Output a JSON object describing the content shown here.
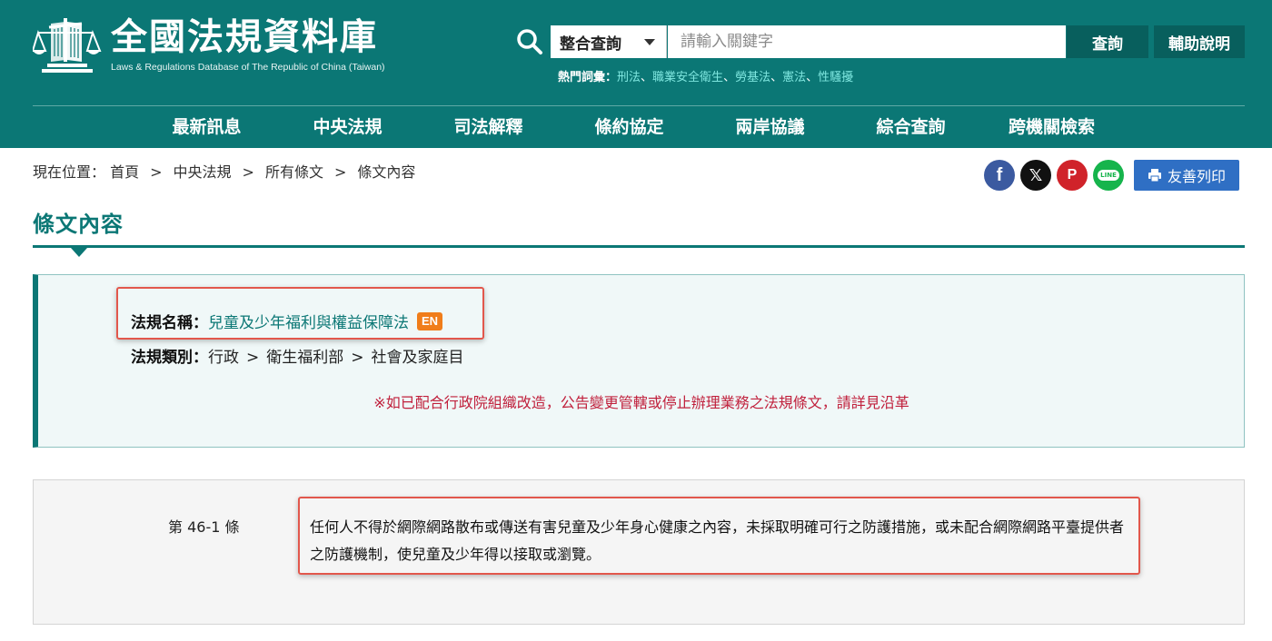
{
  "site": {
    "title": "全國法規資料庫",
    "subtitle": "Laws & Regulations Database of The Republic of China (Taiwan)"
  },
  "search": {
    "scope_selected": "整合查詢",
    "placeholder": "請輸入關鍵字",
    "query_label": "查詢",
    "help_label": "輔助說明",
    "hot_label": "熱門詞彙：",
    "hot_terms": [
      "刑法",
      "職業安全衛生",
      "勞基法",
      "憲法",
      "性騷擾"
    ],
    "hot_sep": "、"
  },
  "nav": {
    "items": [
      "最新訊息",
      "中央法規",
      "司法解釋",
      "條約協定",
      "兩岸協議",
      "綜合查詢",
      "跨機關檢索"
    ]
  },
  "breadcrumb": {
    "prefix": "現在位置：",
    "items": [
      "首頁",
      "中央法規",
      "所有條文",
      "條文內容"
    ],
    "sep": ">"
  },
  "share": {
    "facebook": "f",
    "x": "𝕏",
    "plurk": "P",
    "line": "LINE",
    "print_label": "友善列印"
  },
  "page": {
    "title": "條文內容"
  },
  "law": {
    "name_label": "法規名稱：",
    "name": "兒童及少年福利與權益保障法",
    "en_badge": "EN",
    "category_label": "法規類別：",
    "category": [
      "行政",
      "衛生福利部",
      "社會及家庭目"
    ],
    "category_sep": ">",
    "notice": "※如已配合行政院組織改造，公告變更管轄或停止辦理業務之法規條文，請詳見沿革"
  },
  "article": {
    "number": "第 46-1 條",
    "text": "任何人不得於網際網路散布或傳送有害兒童及少年身心健康之內容，未採取明確可行之防護措施，或未配合網際網路平臺提供者之防護機制，使兒童及少年得以接取或瀏覽。"
  },
  "colors": {
    "brand": "#0b7775",
    "brand_dark": "#085f5d",
    "hot_link": "#7fe7e0",
    "notice": "#c0203c",
    "highlight": "#e2574c",
    "en_badge": "#f07d1a",
    "print_button": "#2f6fc4"
  }
}
